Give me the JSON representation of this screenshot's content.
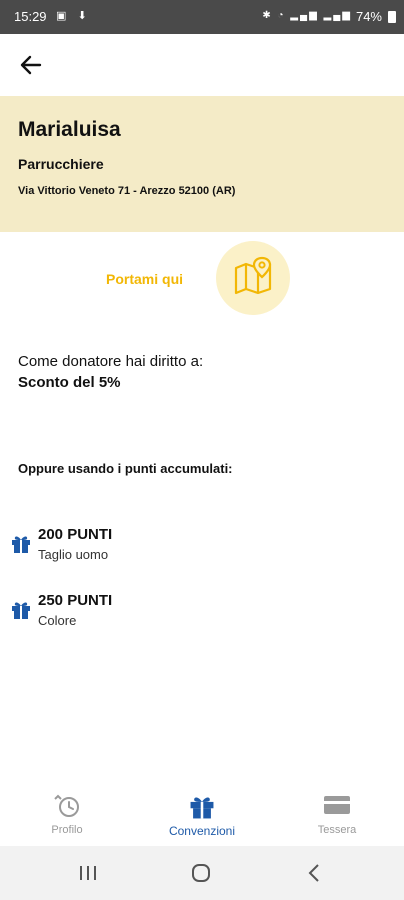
{
  "status_bar": {
    "time": "15:29",
    "battery": "74%"
  },
  "shop": {
    "name": "Marialuisa",
    "category": "Parrucchiere",
    "address": "Via Vittorio Veneto 71 - Arezzo 52100 (AR)"
  },
  "navigate": {
    "label": "Portami qui"
  },
  "donor": {
    "intro": "Come donatore hai diritto a:",
    "discount": "Sconto del 5%"
  },
  "points": {
    "heading": "Oppure usando i punti accumulati:",
    "rewards": [
      {
        "points": "200 PUNTI",
        "description": "Taglio uomo"
      },
      {
        "points": "250 PUNTI",
        "description": "Colore"
      }
    ]
  },
  "bottom_nav": {
    "tabs": [
      {
        "label": "Profilo"
      },
      {
        "label": "Convenzioni"
      },
      {
        "label": "Tessera"
      }
    ],
    "active": "Convenzioni"
  },
  "colors": {
    "header_bg": "#f4ebc7",
    "accent_yellow": "#f2b705",
    "accent_blue": "#1e5aa8"
  }
}
